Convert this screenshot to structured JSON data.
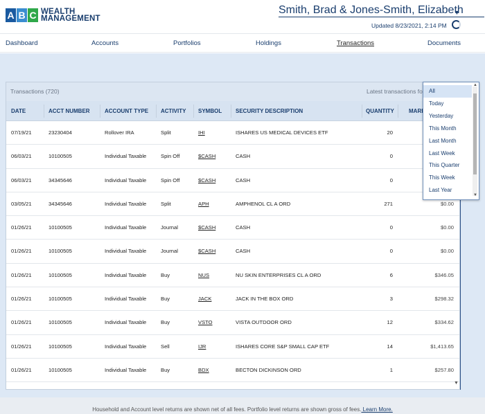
{
  "logo": {
    "letters": [
      "A",
      "B",
      "C"
    ],
    "line1": "WEALTH",
    "line2": "MANAGEMENT"
  },
  "header": {
    "client_name": "Smith, Brad & Jones-Smith, Elizabeth",
    "updated": "Updated 8/23/2021, 2:14 PM"
  },
  "nav": [
    "Dashboard",
    "Accounts",
    "Portfolios",
    "Holdings",
    "Transactions",
    "Documents"
  ],
  "panel": {
    "count": "Transactions (720)",
    "latest_label": "Latest transactions for"
  },
  "columns": [
    "DATE",
    "ACCT NUMBER",
    "ACCOUNT TYPE",
    "ACTIVITY",
    "SYMBOL",
    "SECURITY DESCRIPTION",
    "QUANTITY",
    "MARK"
  ],
  "rows": [
    {
      "date": "07/19/21",
      "acct": "23230404",
      "type": "Rollover IRA",
      "activity": "Split",
      "symbol": "IHI",
      "desc": "ISHARES US MEDICAL DEVICES ETF",
      "qty": "20",
      "mv": ""
    },
    {
      "date": "06/03/21",
      "acct": "10100505",
      "type": "Individual Taxable",
      "activity": "Spin Off",
      "symbol": "$CASH",
      "desc": "CASH",
      "qty": "0",
      "mv": ""
    },
    {
      "date": "06/03/21",
      "acct": "34345646",
      "type": "Individual Taxable",
      "activity": "Spin Off",
      "symbol": "$CASH",
      "desc": "CASH",
      "qty": "0",
      "mv": ""
    },
    {
      "date": "03/05/21",
      "acct": "34345646",
      "type": "Individual Taxable",
      "activity": "Split",
      "symbol": "APH",
      "desc": "AMPHENOL CL A ORD",
      "qty": "271",
      "mv": "$0.00"
    },
    {
      "date": "01/26/21",
      "acct": "10100505",
      "type": "Individual Taxable",
      "activity": "Journal",
      "symbol": "$CASH",
      "desc": "CASH",
      "qty": "0",
      "mv": "$0.00"
    },
    {
      "date": "01/26/21",
      "acct": "10100505",
      "type": "Individual Taxable",
      "activity": "Journal",
      "symbol": "$CASH",
      "desc": "CASH",
      "qty": "0",
      "mv": "$0.00"
    },
    {
      "date": "01/26/21",
      "acct": "10100505",
      "type": "Individual Taxable",
      "activity": "Buy",
      "symbol": "NUS",
      "desc": "NU SKIN ENTERPRISES CL A ORD",
      "qty": "6",
      "mv": "$346.05"
    },
    {
      "date": "01/26/21",
      "acct": "10100505",
      "type": "Individual Taxable",
      "activity": "Buy",
      "symbol": "JACK",
      "desc": "JACK IN THE BOX ORD",
      "qty": "3",
      "mv": "$298.32"
    },
    {
      "date": "01/26/21",
      "acct": "10100505",
      "type": "Individual Taxable",
      "activity": "Buy",
      "symbol": "VSTO",
      "desc": "VISTA OUTDOOR ORD",
      "qty": "12",
      "mv": "$334.62"
    },
    {
      "date": "01/26/21",
      "acct": "10100505",
      "type": "Individual Taxable",
      "activity": "Sell",
      "symbol": "IJR",
      "desc": "ISHARES CORE S&P SMALL CAP ETF",
      "qty": "14",
      "mv": "$1,413.65"
    },
    {
      "date": "01/26/21",
      "acct": "10100505",
      "type": "Individual Taxable",
      "activity": "Buy",
      "symbol": "BDX",
      "desc": "BECTON DICKINSON ORD",
      "qty": "1",
      "mv": "$257.80"
    }
  ],
  "dropdown": {
    "options": [
      "All",
      "Today",
      "Yesterday",
      "This Month",
      "Last Month",
      "Last Week",
      "This Quarter",
      "This Week",
      "Last Year"
    ],
    "selected": "All"
  },
  "footer": {
    "text": "Household and Account level returns are shown net of all fees. Portfolio level returns are shown gross of fees.",
    "link": " Learn More."
  },
  "icons": {
    "refresh": "refresh-icon",
    "caret": "chevron-down-icon",
    "scroll_up": "scroll-up-icon",
    "scroll_down": "scroll-down-icon"
  },
  "colors": {
    "brand_navy": "#1a3e6e",
    "logo_blue": "#1a5aa0",
    "logo_light_blue": "#3a8dd0",
    "logo_green": "#2fa84a",
    "band": "#dde8f5",
    "panel_accent": "#2b4f86"
  }
}
